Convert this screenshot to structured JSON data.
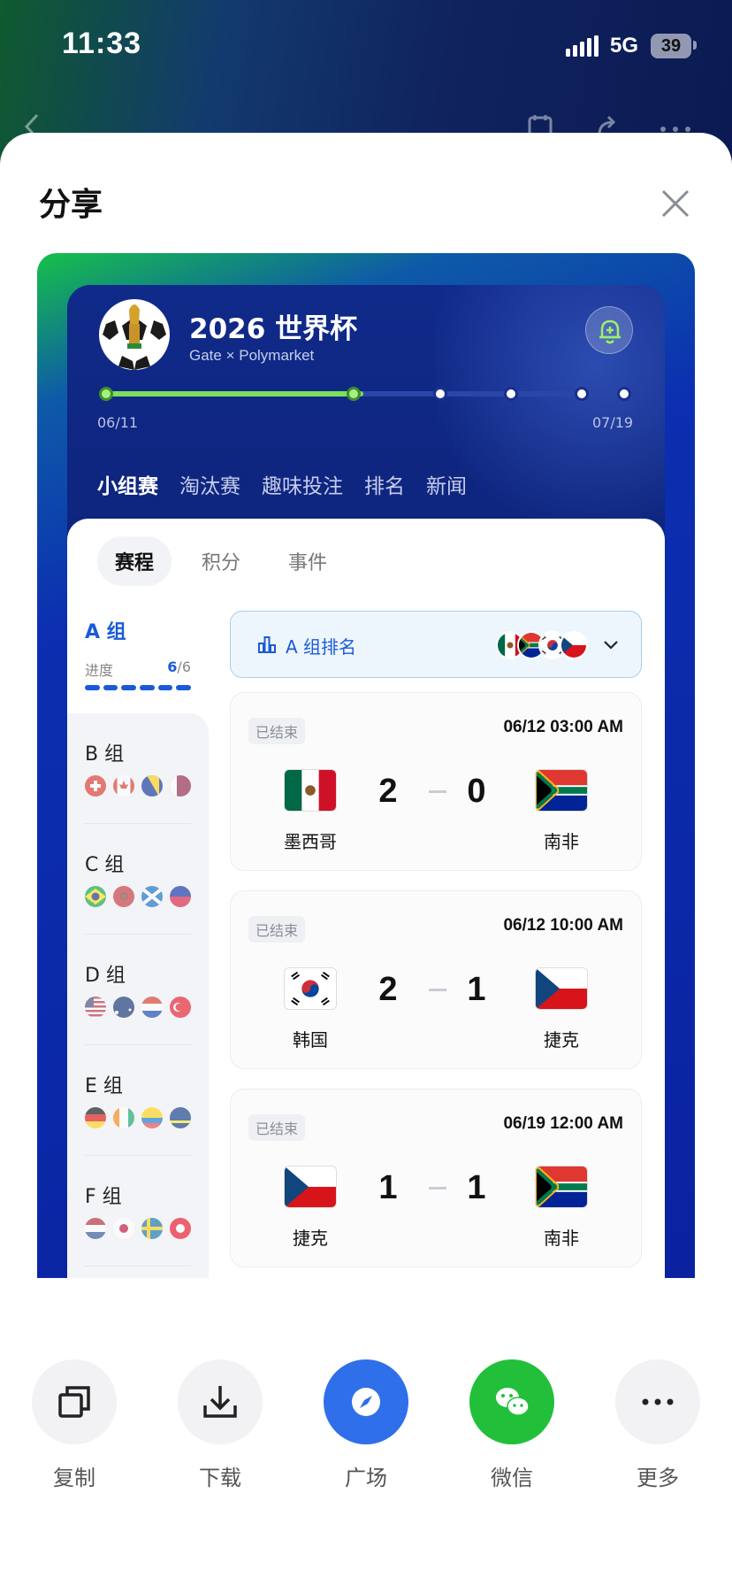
{
  "status_bar": {
    "time": "11:33",
    "network": "5G",
    "battery": "39"
  },
  "sheet": {
    "title": "分享"
  },
  "header": {
    "title": "2026 世界杯",
    "subtitle": "Gate × Polymarket"
  },
  "timeline": {
    "start": "06/11",
    "end": "07/19",
    "progress": 0.5
  },
  "tabs": [
    {
      "label": "小组赛",
      "active": true
    },
    {
      "label": "淘汰赛",
      "active": false
    },
    {
      "label": "趣味投注",
      "active": false
    },
    {
      "label": "排名",
      "active": false
    },
    {
      "label": "新闻",
      "active": false
    }
  ],
  "subtabs": [
    {
      "label": "赛程",
      "active": true
    },
    {
      "label": "积分",
      "active": false
    },
    {
      "label": "事件",
      "active": false
    }
  ],
  "groups": {
    "active": {
      "name": "A 组",
      "progress_label": "进度",
      "progress_done": "6",
      "progress_total": "/6"
    },
    "others": [
      {
        "name": "B 组",
        "flags": [
          "switzerland",
          "canada",
          "bosnia",
          "qatar"
        ]
      },
      {
        "name": "C 组",
        "flags": [
          "brazil",
          "morocco",
          "scotland",
          "haiti"
        ]
      },
      {
        "name": "D 组",
        "flags": [
          "usa",
          "australia",
          "paraguay",
          "turkey"
        ]
      },
      {
        "name": "E 组",
        "flags": [
          "germany",
          "ivory-coast",
          "ecuador",
          "curacao"
        ]
      },
      {
        "name": "F 组",
        "flags": [
          "netherlands",
          "japan",
          "sweden",
          "tunisia"
        ]
      }
    ]
  },
  "ranking": {
    "label": "A 组排名",
    "flags": [
      "mexico",
      "south-africa",
      "south-korea",
      "czech"
    ]
  },
  "matches": [
    {
      "status": "已结束",
      "datetime": "06/12 03:00 AM",
      "home": "墨西哥",
      "away": "南非",
      "home_flag": "mexico",
      "away_flag": "south-africa",
      "home_score": "2",
      "away_score": "0"
    },
    {
      "status": "已结束",
      "datetime": "06/12 10:00 AM",
      "home": "韩国",
      "away": "捷克",
      "home_flag": "south-korea",
      "away_flag": "czech",
      "home_score": "2",
      "away_score": "1"
    },
    {
      "status": "已结束",
      "datetime": "06/19 12:00 AM",
      "home": "捷克",
      "away": "南非",
      "home_flag": "czech",
      "away_flag": "south-africa",
      "home_score": "1",
      "away_score": "1"
    }
  ],
  "share_options": [
    {
      "label": "复制",
      "icon": "copy-icon"
    },
    {
      "label": "下载",
      "icon": "download-icon"
    },
    {
      "label": "广场",
      "icon": "compass-icon"
    },
    {
      "label": "微信",
      "icon": "wechat-icon"
    },
    {
      "label": "更多",
      "icon": "more-icon"
    }
  ],
  "colors": {
    "accent": "#1a5ad8",
    "progress_green": "#7be05a",
    "compass_blue": "#2f6fea",
    "wechat_green": "#22c03a"
  }
}
